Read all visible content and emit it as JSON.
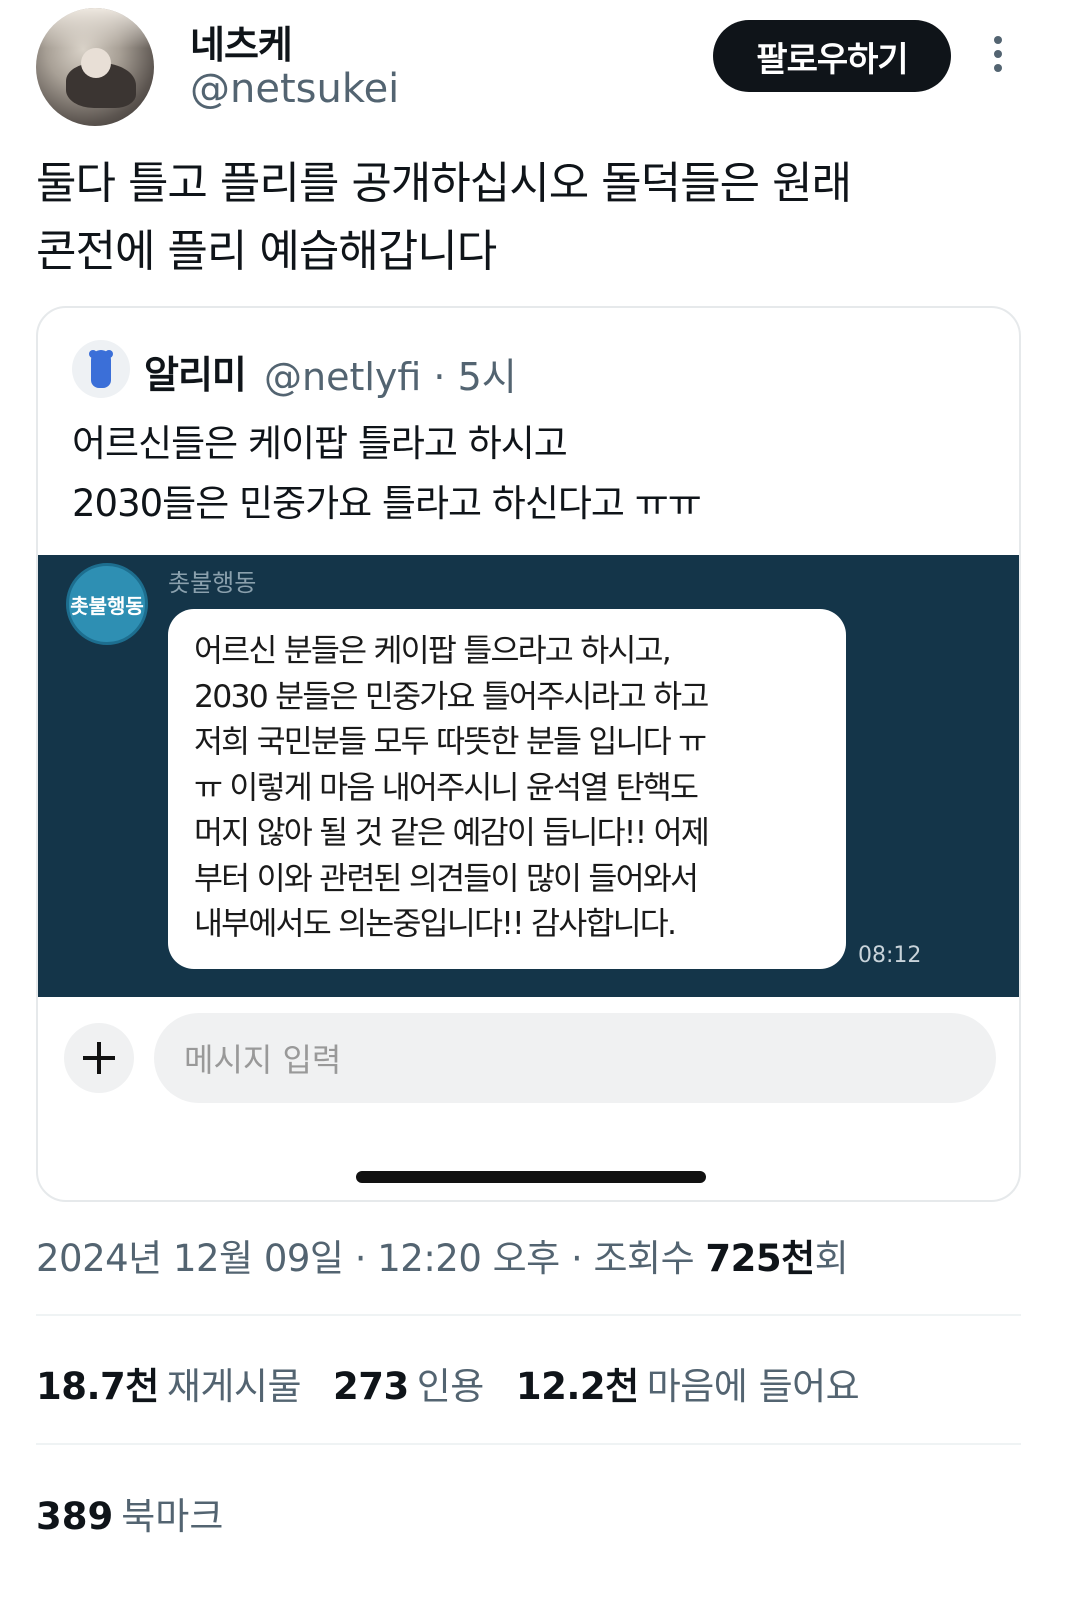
{
  "author": {
    "display_name": "네츠케",
    "handle": "@netsukei",
    "follow_label": "팔로우하기"
  },
  "tweet": {
    "lines": [
      "둘다 틀고 플리를 공개하십시오 돌덕들은 원래",
      "콘전에 플리 예습해갑니다"
    ]
  },
  "quote": {
    "name": "알리미",
    "handle_time": "@netlyfi · 5시",
    "lines": [
      "어르신들은 케이팝 틀라고 하시고",
      "2030들은 민중가요 틀라고 하신다고 ㅠㅠ"
    ],
    "chat": {
      "avatar_text": "촛불행동",
      "sender": "촛불행동",
      "message_lines": [
        "어르신 분들은 케이팝 틀으라고 하시고,",
        "2030 분들은 민중가요 틀어주시라고 하고",
        "저희 국민분들 모두 따뜻한 분들 입니다 ㅠ",
        "ㅠ 이렇게 마음 내어주시니 윤석열 탄핵도",
        "머지 않아 될 것 같은 예감이 듭니다!! 어제",
        "부터 이와 관련된 의견들이 많이 들어와서",
        "내부에서도 의논중입니다!! 감사합니다."
      ],
      "time": "08:12",
      "input_placeholder": "메시지 입력"
    }
  },
  "meta": {
    "timestamp": "2024년 12월 09일 · 12:20 오후 · 조회수 ",
    "views": "725천",
    "views_suffix": "회"
  },
  "stats": {
    "retweets_count": "18.7천",
    "retweets_label": "재게시물",
    "quotes_count": "273",
    "quotes_label": "인용",
    "likes_count": "12.2천",
    "likes_label": "마음에 들어요",
    "bookmarks_count": "389",
    "bookmarks_label": "북마크"
  },
  "colors": {
    "chat_background": "#143549",
    "secondary_text": "#536471",
    "follow_button": "#0f1419"
  }
}
